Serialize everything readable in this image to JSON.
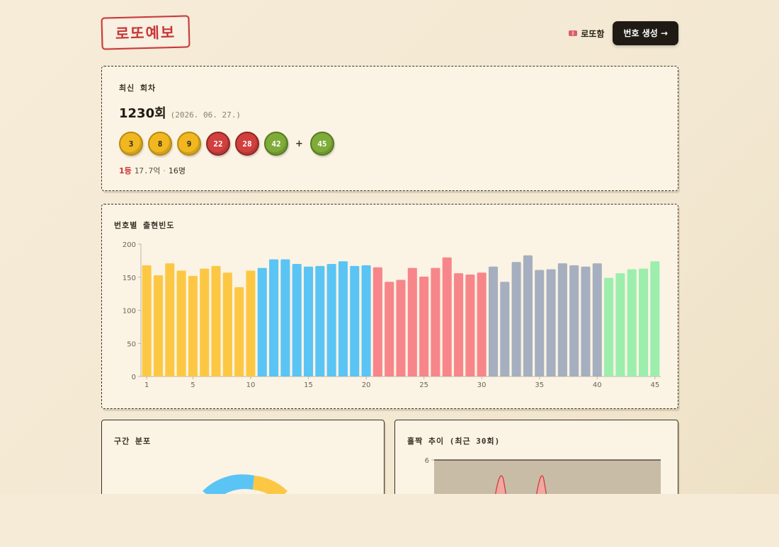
{
  "header": {
    "logo": "로또예보",
    "nav_link": "로또함",
    "nav_icon": "ticket-icon",
    "generate_button": "번호 생성 →"
  },
  "latest": {
    "label": "최신 회차",
    "round": "1230회",
    "date": "(2026. 06. 27.)",
    "balls": [
      {
        "n": "3",
        "color": "y"
      },
      {
        "n": "8",
        "color": "y"
      },
      {
        "n": "9",
        "color": "y"
      },
      {
        "n": "22",
        "color": "r"
      },
      {
        "n": "28",
        "color": "r"
      },
      {
        "n": "42",
        "color": "g"
      }
    ],
    "plus": "+",
    "bonus": {
      "n": "45",
      "color": "g"
    },
    "prize_rank": "1등",
    "prize_amount": "17.7억",
    "prize_sep": "·",
    "prize_winners": "16명"
  },
  "frequency": {
    "title": "번호별 출현빈도",
    "colors": {
      "1-10": "#fcc844",
      "11-20": "#5ac4f5",
      "21-30": "#f7868a",
      "31-40": "#a6afbf",
      "41-45": "#9ceead"
    }
  },
  "distribution": {
    "title": "구간 분포"
  },
  "oddeven": {
    "title": "홀짝 추이 (최근 30회)"
  },
  "chart_data": [
    {
      "type": "bar",
      "categories": [
        "1",
        "2",
        "3",
        "4",
        "5",
        "6",
        "7",
        "8",
        "9",
        "10",
        "11",
        "12",
        "13",
        "14",
        "15",
        "16",
        "17",
        "18",
        "19",
        "20",
        "21",
        "22",
        "23",
        "24",
        "25",
        "26",
        "27",
        "28",
        "29",
        "30",
        "31",
        "32",
        "33",
        "34",
        "35",
        "36",
        "37",
        "38",
        "39",
        "40",
        "41",
        "42",
        "43",
        "44",
        "45"
      ],
      "values": [
        168,
        153,
        171,
        160,
        152,
        163,
        167,
        157,
        135,
        160,
        164,
        177,
        177,
        170,
        166,
        167,
        170,
        174,
        167,
        168,
        165,
        143,
        146,
        164,
        151,
        164,
        180,
        156,
        154,
        157,
        166,
        143,
        173,
        183,
        161,
        162,
        171,
        168,
        166,
        171,
        149,
        156,
        162,
        163,
        174
      ],
      "tick_labels_x": [
        "1",
        "5",
        "10",
        "15",
        "20",
        "25",
        "30",
        "35",
        "40",
        "45"
      ],
      "tick_labels_y": [
        "0",
        "50",
        "100",
        "150",
        "200"
      ],
      "ylim": [
        0,
        200
      ],
      "xlabel": "",
      "ylabel": "",
      "title": "번호별 출현빈도"
    },
    {
      "type": "area",
      "title": "홀짝 추이 (최근 30회)",
      "tick_labels_y": [
        "6"
      ],
      "ylim": [
        0,
        6
      ]
    }
  ]
}
